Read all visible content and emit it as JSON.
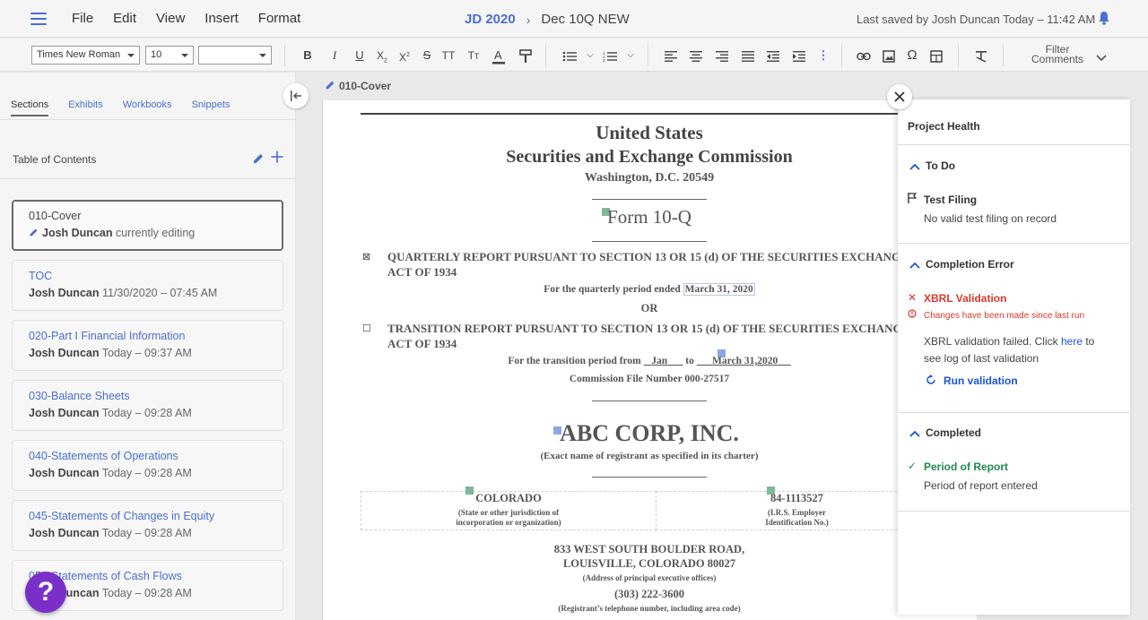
{
  "app": {
    "menu": [
      "File",
      "Edit",
      "View",
      "Insert",
      "Format"
    ],
    "project": "JD 2020",
    "document": "Dec 10Q NEW",
    "last_saved": "Last saved by Josh Duncan Today – 11:42 AM"
  },
  "toolbar": {
    "font_family": "Times New Roman",
    "font_size": "10",
    "style": "",
    "filter_label": "Filter",
    "comments_label": "Comments"
  },
  "sidebar": {
    "tabs": [
      "Sections",
      "Exhibits",
      "Workbooks",
      "Snippets"
    ],
    "active_tab": "Sections",
    "toc_heading": "Table of Contents",
    "sections": [
      {
        "title": "010-Cover",
        "user": "Josh Duncan",
        "meta": "currently editing",
        "active": true
      },
      {
        "title": "TOC",
        "user": "Josh Duncan",
        "meta": "11/30/2020 – 07:45 AM"
      },
      {
        "title": "020-Part I Financial Information",
        "user": "Josh Duncan",
        "meta": "Today – 09:37 AM"
      },
      {
        "title": "030-Balance Sheets",
        "user": "Josh Duncan",
        "meta": "Today – 09:28 AM"
      },
      {
        "title": "040-Statements of Operations",
        "user": "Josh Duncan",
        "meta": "Today – 09:28 AM"
      },
      {
        "title": "045-Statements of Changes in Equity",
        "user": "Josh Duncan",
        "meta": "Today – 09:28 AM"
      },
      {
        "title": "050-Statements of Cash Flows",
        "user": "Josh Duncan",
        "meta": "Today – 09:28 AM"
      }
    ],
    "help_label": "?"
  },
  "document": {
    "section_label": "010-Cover",
    "title_1": "United States",
    "title_2": "Securities and Exchange Commission",
    "city": "Washington, D.C. 20549",
    "form": "Form 10-Q",
    "quarterly_check": "⊠",
    "quarterly_1": "QUARTERLY REPORT PURSUANT TO SECTION 13 OR 15 (d) OF THE SECURITIES EXCHANGE",
    "quarterly_2": "ACT OF 1934",
    "quarter_period_label": "For the quarterly period ended",
    "quarter_period_value": "March 31, 2020",
    "or": "OR",
    "transition_check": "☐",
    "transition_1": "TRANSITION REPORT PURSUANT TO SECTION 13 OR 15 (d) OF THE SECURITIES EXCHANGE",
    "transition_2": "ACT OF 1934",
    "transition_label": "For the transition period from",
    "transition_from": "Jan",
    "transition_to_label": "to",
    "transition_to": "March 31,2020",
    "commission_file": "Commission File Number 000-27517",
    "company": "ABC CORP, INC.",
    "company_sub": "(Exact name of registrant as specified in its charter)",
    "state": "COLORADO",
    "state_sub_1": "(State or other jurisdiction of",
    "state_sub_2": "incorporation or organization)",
    "ein": "84-1113527",
    "ein_sub_1": "(I.R.S. Employer",
    "ein_sub_2": "Identification No.)",
    "address_1": "833 WEST SOUTH BOULDER ROAD,",
    "address_2": "LOUISVILLE, COLORADO 80027",
    "address_sub": "(Address of principal executive offices)",
    "phone": "(303) 222-3600",
    "phone_sub": "(Registrant’s telephone number, including area code)"
  },
  "health": {
    "title": "Project Health",
    "todo_heading": "To Do",
    "todo_item_title": "Test Filing",
    "todo_item_text": "No valid test filing on record",
    "error_heading": "Completion Error",
    "error_item_title": "XBRL Validation",
    "error_item_sub": "Changes have been made since last run",
    "error_text_1": "XBRL validation failed. Click",
    "error_link": "here",
    "error_text_2": "to",
    "error_text_3": "see log of last validation",
    "run_label": "Run validation",
    "completed_heading": "Completed",
    "completed_item_title": "Period of Report",
    "completed_item_text": "Period of report entered"
  },
  "colors": {
    "accent": "#4a6ed1",
    "error": "#d93a2e",
    "success": "#1f8a4c",
    "help": "#7a2fc9"
  }
}
